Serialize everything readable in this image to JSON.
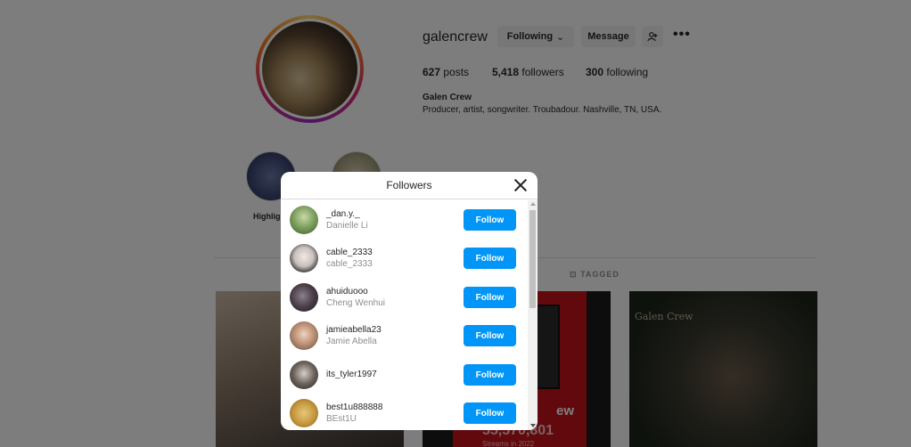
{
  "profile": {
    "username": "galencrew",
    "following_label": "Following",
    "message_label": "Message",
    "more_label": "•••",
    "posts_count": "627",
    "posts_label": "posts",
    "followers_count": "5,418",
    "followers_label": "followers",
    "following_count": "300",
    "following_word": "following",
    "full_name": "Galen Crew",
    "bio": "Producer, artist, songwriter. Troubadour. Nashville, TN, USA.",
    "highlight_label": "Highligh",
    "tab_tagged": "TAGGED"
  },
  "posts": {
    "post2_big": "55,570,801",
    "post2_small": "Streams in 2022",
    "post2_ew": "ew",
    "post3_tag": "Galen Crew"
  },
  "modal": {
    "title": "Followers",
    "followers": [
      {
        "username": "_dan.y._",
        "subtitle": "Danielle Li",
        "button": "Follow"
      },
      {
        "username": "cable_2333",
        "subtitle": "cable_2333",
        "button": "Follow"
      },
      {
        "username": "ahuiduooo",
        "subtitle": "Cheng Wenhui",
        "button": "Follow"
      },
      {
        "username": "jamieabella23",
        "subtitle": "Jamie Abella",
        "button": "Follow"
      },
      {
        "username": "its_tyler1997",
        "subtitle": "",
        "button": "Follow"
      },
      {
        "username": "best1u888888",
        "subtitle": "BEst1U",
        "button": "Follow"
      }
    ]
  },
  "colors": {
    "follow_button": "#0095f6",
    "overlay": "rgba(0,0,0,0.5)"
  },
  "icons": [
    "chevron-down-icon",
    "add-user-icon",
    "more-icon",
    "close-icon",
    "tagged-icon"
  ]
}
